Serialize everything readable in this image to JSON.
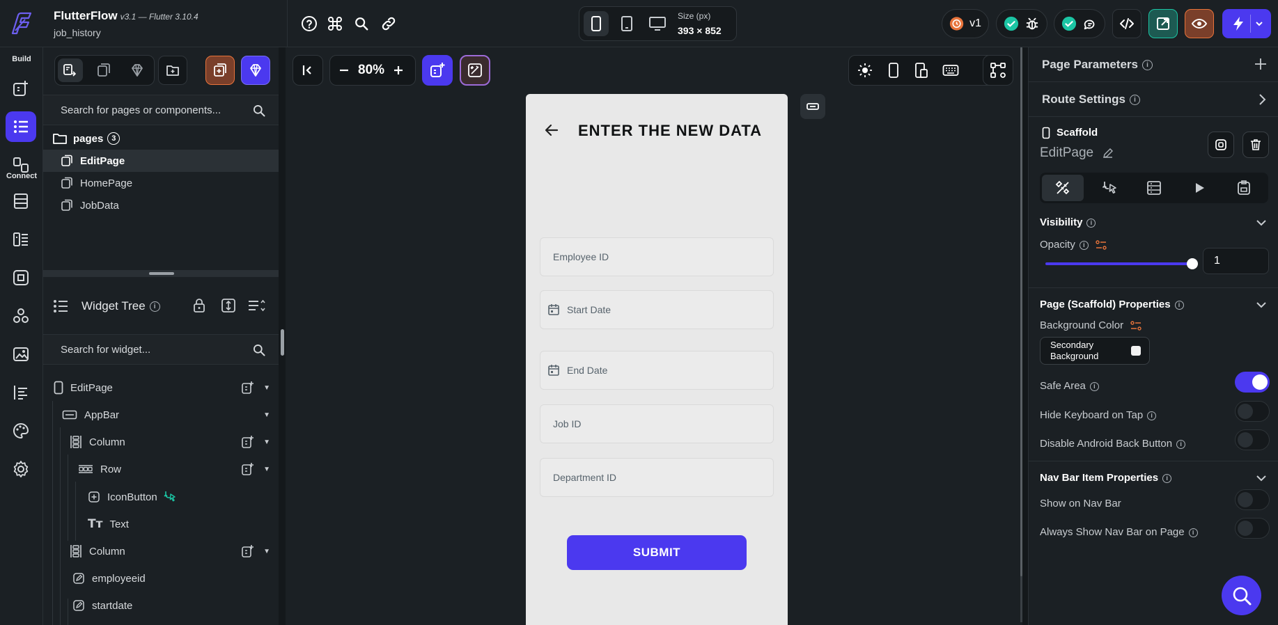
{
  "app": {
    "name": "FlutterFlow",
    "version": "v3.1 — Flutter 3.10.4",
    "project": "job_history"
  },
  "topbar": {
    "size_label": "Size (px)",
    "size_value": "393 × 852",
    "version_badge": "v1",
    "colors": {
      "accent": "#4b39ef",
      "success": "#1bc5a4",
      "warn": "#e8743b"
    }
  },
  "rail": {
    "build_label": "Build",
    "connect_label": "Connect"
  },
  "left_panel": {
    "search_placeholder": "Search for pages or components...",
    "folder": {
      "name": "pages",
      "count": "3"
    },
    "pages": [
      "EditPage",
      "HomePage",
      "JobData"
    ],
    "widget_tree_title": "Widget Tree",
    "widget_search_placeholder": "Search for widget...",
    "tree": [
      {
        "label": "EditPage",
        "icon": "phone-icon"
      },
      {
        "label": "AppBar",
        "icon": "appbar-icon"
      },
      {
        "label": "Column",
        "icon": "column-icon"
      },
      {
        "label": "Row",
        "icon": "row-icon"
      },
      {
        "label": "IconButton",
        "icon": "add-box-icon"
      },
      {
        "label": "Text",
        "icon": "text-icon"
      },
      {
        "label": "Column",
        "icon": "column-icon"
      },
      {
        "label": "employeeid",
        "icon": "edit-icon"
      },
      {
        "label": "startdate",
        "icon": "edit-icon"
      }
    ]
  },
  "canvas": {
    "zoom": "80%",
    "phone": {
      "title": "ENTER THE NEW DATA",
      "fields": [
        {
          "placeholder": "Employee ID",
          "icon": ""
        },
        {
          "placeholder": "Start Date",
          "icon": "calendar-icon"
        },
        {
          "placeholder": "End Date",
          "icon": "calendar-icon"
        },
        {
          "placeholder": "Job ID",
          "icon": ""
        },
        {
          "placeholder": "Department ID",
          "icon": ""
        }
      ],
      "submit_label": "SUBMIT"
    }
  },
  "right_panel": {
    "page_parameters": "Page Parameters",
    "route_settings": "Route Settings",
    "widget_type": "Scaffold",
    "page_name": "EditPage",
    "visibility_title": "Visibility",
    "opacity_label": "Opacity",
    "opacity_value": "1",
    "opacity_level": 1,
    "scaffold_title": "Page (Scaffold) Properties",
    "bg_color_label": "Background Color",
    "bg_color_value": "Secondary Background",
    "safe_area_label": "Safe Area",
    "safe_area_on": true,
    "hide_keyboard_label": "Hide Keyboard on Tap",
    "disable_back_label": "Disable Android Back Button",
    "navbar_title": "Nav Bar Item Properties",
    "show_navbar_label": "Show on Nav Bar",
    "always_navbar_label": "Always Show Nav Bar on Page"
  }
}
